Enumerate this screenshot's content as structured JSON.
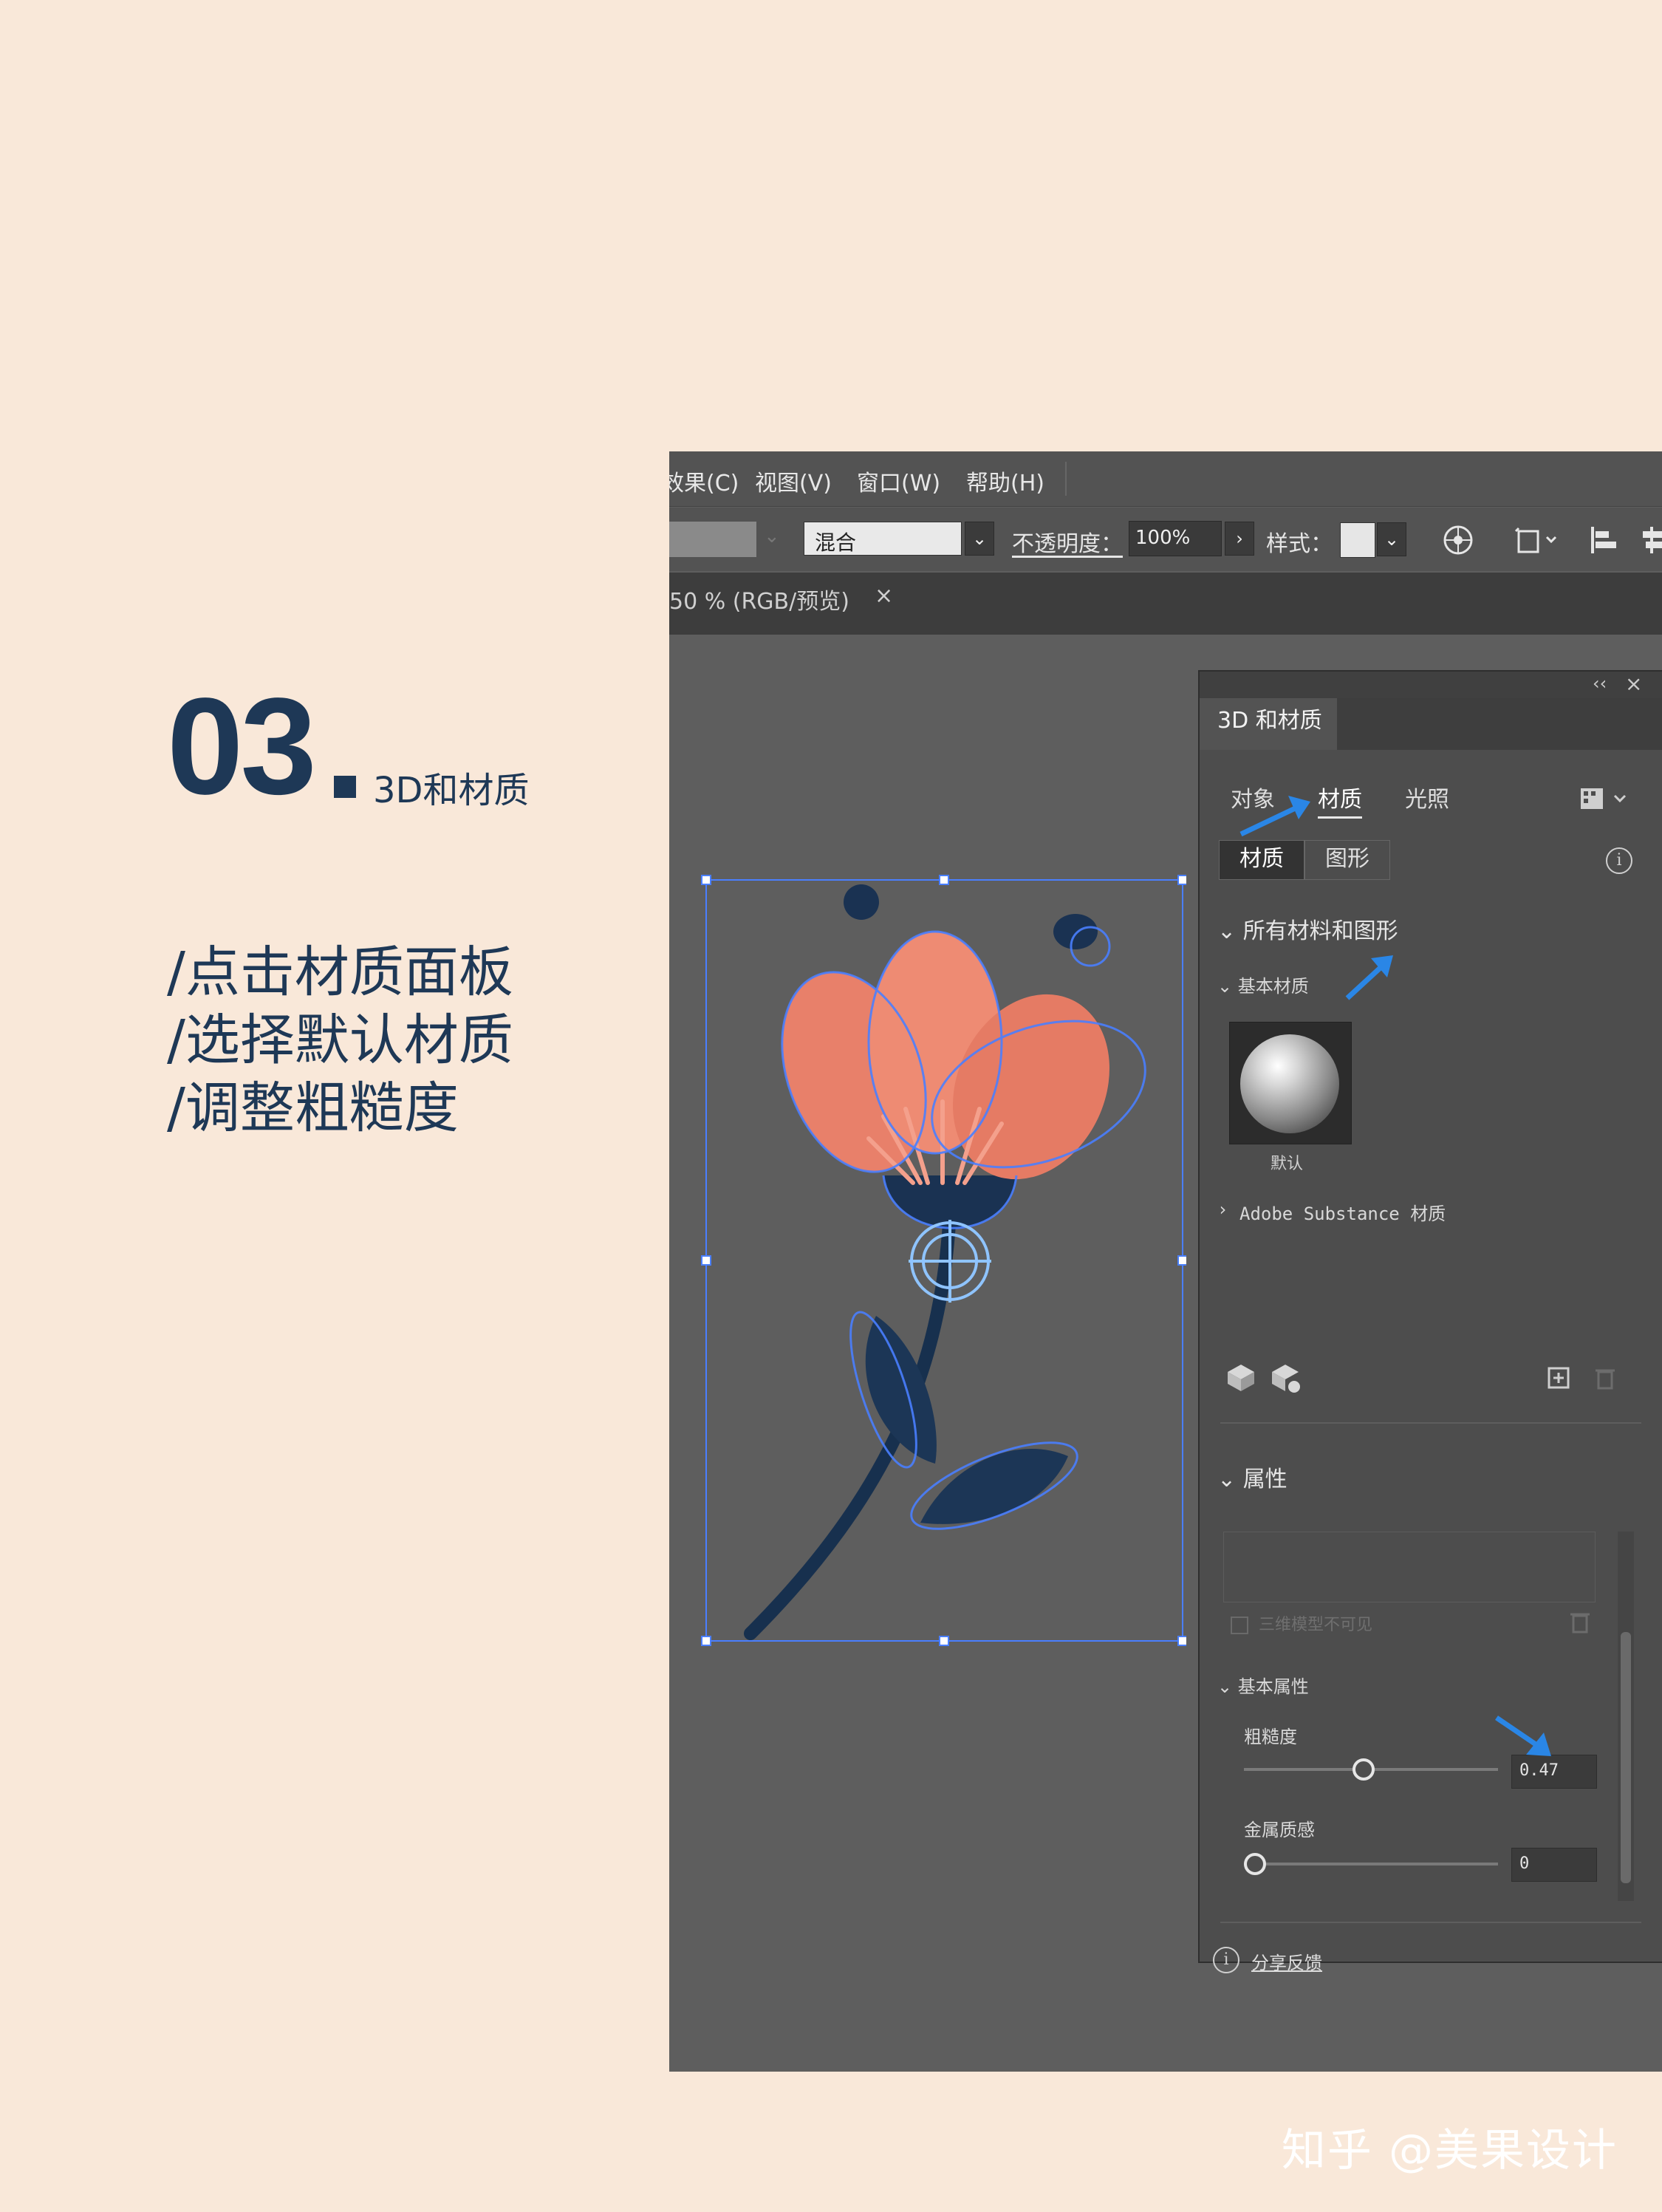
{
  "tutorial": {
    "step_number": "03",
    "step_title": "3D和材质",
    "instructions": [
      "/点击材质面板",
      "/选择默认材质",
      "/调整粗糙度"
    ]
  },
  "watermark": "知乎 @美果设计",
  "menubar": {
    "items": [
      "效果(C)",
      "视图(V)",
      "窗口(W)",
      "帮助(H)"
    ]
  },
  "controlbar": {
    "blend_mode": "混合",
    "opacity_label": "不透明度：",
    "opacity_value": "100%",
    "style_label": "样式："
  },
  "document_tab": {
    "label": "50 % (RGB/预览)",
    "close": "×"
  },
  "panel": {
    "title": "3D 和材质",
    "collapse": "‹‹",
    "close": "×",
    "tabs": [
      "对象",
      "材质",
      "光照"
    ],
    "active_tab": "材质",
    "segments": [
      "材质",
      "图形"
    ],
    "all_materials_heading": "所有材料和图形",
    "basic_materials_heading": "基本材质",
    "default_material_label": "默认",
    "substance_heading": "Adobe Substance 材质",
    "properties_heading": "属性",
    "invisible_checkbox_label": "三维模型不可见",
    "basic_properties_heading": "基本属性",
    "roughness": {
      "label": "粗糙度",
      "value": "0.47",
      "level": 0.47
    },
    "metallic": {
      "label": "金属质感",
      "value": "0",
      "level": 0
    },
    "feedback_link": "分享反馈"
  },
  "colors": {
    "background": "#f9e8d9",
    "heading": "#1e3856",
    "petal": "#e8806a",
    "stem": "#1c3656",
    "selection": "#4a7fff",
    "annotation_arrow": "#2a86e6"
  }
}
